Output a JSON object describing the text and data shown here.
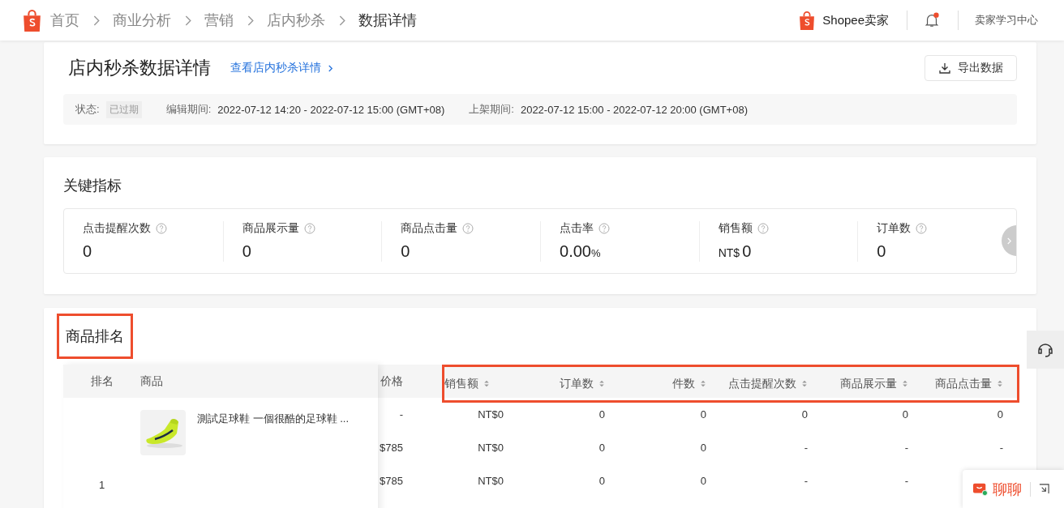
{
  "breadcrumb": [
    {
      "label": "首页"
    },
    {
      "label": "商业分析"
    },
    {
      "label": "营销"
    },
    {
      "label": "店内秒杀"
    },
    {
      "label": "数据详情"
    }
  ],
  "header": {
    "brand": "Shopee卖家",
    "notification_dot": true,
    "learning_center": "卖家学习中心"
  },
  "summary": {
    "title": "店内秒杀数据详情",
    "detail_link": "查看店内秒杀详情",
    "export_button": "导出数据",
    "status_label": "状态:",
    "status": "已过期",
    "edit_label": "编辑期间:",
    "edit_period": "2022-07-12 14:20 - 2022-07-12 15:00 (GMT+08)",
    "listing_label": "上架期间:",
    "listing_period": "2022-07-12 15:00 - 2022-07-12 20:00 (GMT+08)"
  },
  "key_metrics": {
    "title": "关键指标",
    "items": [
      {
        "label": "点击提醒次数",
        "value": "0"
      },
      {
        "label": "商品展示量",
        "value": "0"
      },
      {
        "label": "商品点击量",
        "value": "0"
      },
      {
        "label": "点击率",
        "value": "0.00",
        "suffix": "%"
      },
      {
        "label": "销售额",
        "prefix": "NT$",
        "value": "0"
      },
      {
        "label": "订单数",
        "value": "0"
      }
    ]
  },
  "ranking": {
    "title": "商品排名",
    "title_highlighted": true,
    "table": {
      "rank_header": "排名",
      "product_header": "商品",
      "price_header": "价格",
      "metrics_highlighted": true,
      "columns": [
        {
          "label": "销售额"
        },
        {
          "label": "订单数"
        },
        {
          "label": "件数"
        },
        {
          "label": "点击提醒次数"
        },
        {
          "label": "商品展示量"
        },
        {
          "label": "商品点击量"
        }
      ],
      "product": {
        "rank": "1",
        "name": "測試足球鞋 一個很酷的足球鞋 ..."
      },
      "rows": [
        {
          "price": "-",
          "cells": [
            "NT$0",
            "0",
            "0",
            "0",
            "0",
            "0"
          ]
        },
        {
          "price": "$785",
          "cells": [
            "NT$0",
            "0",
            "0",
            "-",
            "-",
            "-"
          ]
        },
        {
          "price": "$785",
          "cells": [
            "NT$0",
            "0",
            "0",
            "-",
            "-"
          ]
        }
      ]
    }
  },
  "chat": {
    "label": "聊聊"
  }
}
